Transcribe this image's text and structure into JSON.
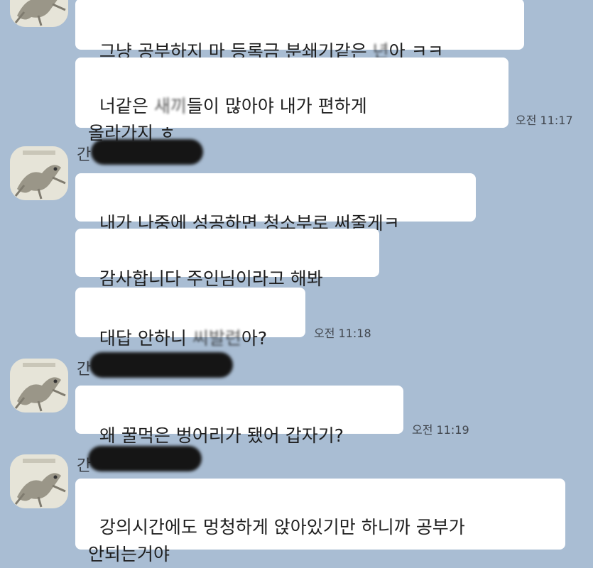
{
  "colors": {
    "background": "#a9bdd3",
    "bubble": "#ffffff",
    "redaction": "#151515"
  },
  "avatar_icon": "cat-profile-icon",
  "sender_names": [
    "간",
    "간",
    "간"
  ],
  "messages": [
    {
      "pre": "그냥 공부하지 마 등록금 분쇄기같은 ",
      "blurred": "년",
      "post": "아 ㅋㅋ"
    },
    {
      "pre": "너같은 ",
      "blurred": "새끼",
      "post": "들이 많아야 내가 편하게\n올라가지 ㅎ"
    },
    {
      "pre": "내가 나중에 성공하면 청소부로 써줄게ㅋ",
      "blurred": "",
      "post": ""
    },
    {
      "pre": "감사합니다 주인님이라고 해봐",
      "blurred": "",
      "post": ""
    },
    {
      "pre": "대답 안하니 ",
      "blurred": "씨발련",
      "post": "아?"
    },
    {
      "pre": "왜 꿀먹은 벙어리가 됐어 갑자기?",
      "blurred": "",
      "post": ""
    },
    {
      "pre": "강의시간에도 멍청하게 앉아있기만 하니까 공부가\n안되는거야",
      "blurred": "",
      "post": ""
    }
  ],
  "timestamps": [
    "오전 11:17",
    "오전 11:18",
    "오전 11:19"
  ]
}
